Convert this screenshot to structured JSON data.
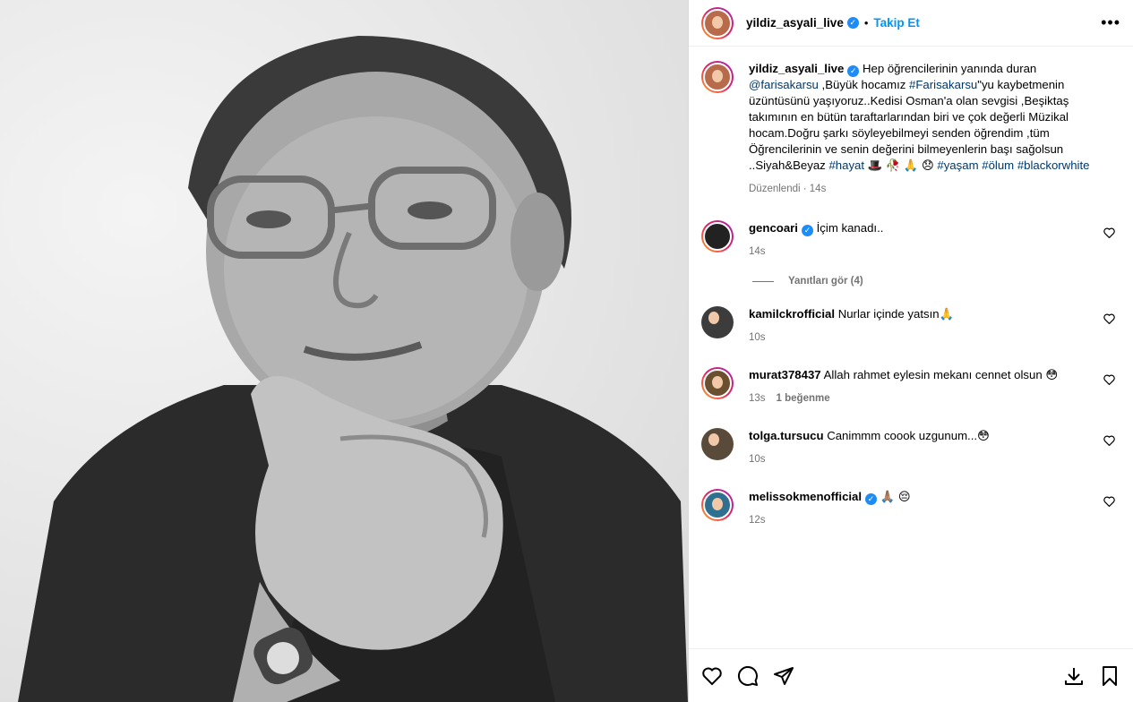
{
  "post": {
    "username": "yildiz_asyali_live",
    "verified_icon": "verified-badge-icon",
    "dot": "•",
    "follow_label": "Takip Et",
    "more_icon": "more-options-icon"
  },
  "caption": {
    "username": "yildiz_asyali_live",
    "text_1": " Hep öğrencilerinin yanında duran ",
    "mention": "@farisakarsu",
    "text_2": " ,Büyük hocamız ",
    "hashtag_1": "#Farisakarsu",
    "text_3": "\"yu kaybetmenin üzüntüsünü yaşıyoruz..Kedisi Osman'a olan sevgisi ,Beşiktaş takımının en bütün taraftarlarından biri ve çok değerli Müzikal hocam.Doğru şarkı söyleyebilmeyi senden öğrendim ,tüm Öğrencilerinin ve senin değerini bilmeyenlerin başı sağolsun ..Siyah&Beyaz ",
    "hashtag_2": "#hayat",
    "emojis": " 🎩 🥀 🙏 😞 ",
    "hashtag_3": "#yaşam",
    "hashtag_4": "#ölum",
    "hashtag_5": "#blackorwhite",
    "edited": "Düzenlendi",
    "time": "14s"
  },
  "comments": [
    {
      "username": "gencoari",
      "verified": true,
      "text": "İçim kanadı..",
      "time": "14s",
      "likes": ""
    },
    {
      "username": "kamilckrofficial",
      "verified": false,
      "text": "Nurlar içinde yatsın🙏",
      "time": "10s",
      "likes": ""
    },
    {
      "username": "murat378437",
      "verified": false,
      "text": "Allah rahmet eylesin mekanı cennet olsun 😳",
      "time": "13s",
      "likes": "1 beğenme"
    },
    {
      "username": "tolga.tursucu",
      "verified": false,
      "text": "Canimmm coook uzgunum...😳",
      "time": "10s",
      "likes": ""
    },
    {
      "username": "melissokmenofficial",
      "verified": true,
      "text": "🙏🏽 😔",
      "time": "12s",
      "likes": ""
    }
  ],
  "replies_label": "Yanıtları gör (4)",
  "footer": {
    "like_icon": "heart-icon",
    "comment_icon": "comment-icon",
    "share_icon": "share-icon",
    "download_icon": "download-icon",
    "save_icon": "bookmark-icon"
  }
}
